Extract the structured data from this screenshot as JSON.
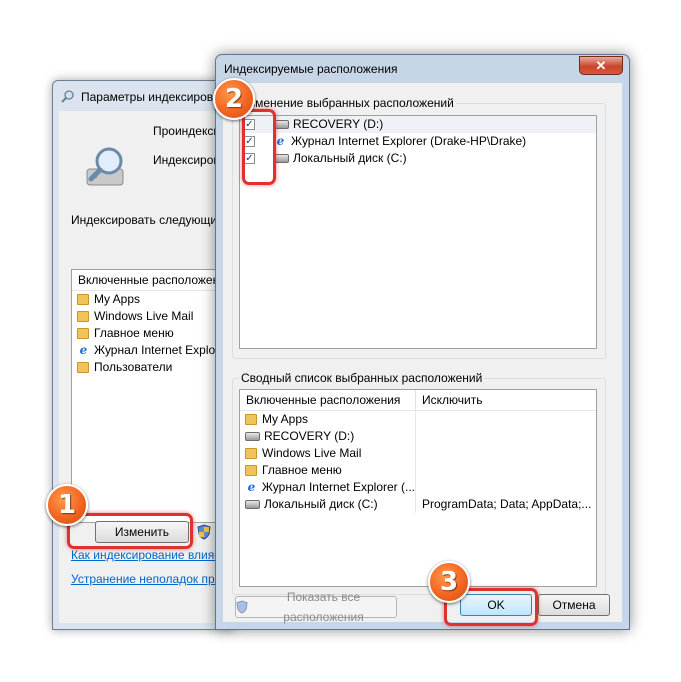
{
  "back_window": {
    "title": "Параметры индексиров",
    "status_line_1": "Проиндекси",
    "status_line_2": "Индексиров",
    "index_prompt": "Индексировать следующие",
    "list_header": "Включенные расположения",
    "items": [
      {
        "icon": "folder-icon",
        "label": "My Apps"
      },
      {
        "icon": "folder-icon",
        "label": "Windows Live Mail"
      },
      {
        "icon": "folder-icon",
        "label": "Главное меню"
      },
      {
        "icon": "ie-icon",
        "label": "Журнал Internet Explorer"
      },
      {
        "icon": "folder-icon",
        "label": "Пользователи"
      }
    ],
    "modify_button": "Изменить",
    "link1": "Как индексирование влияет",
    "link2": "Устранение неполадок при и"
  },
  "dialog": {
    "title": "Индексируемые расположения",
    "close": "✕",
    "group1_title": "Изменение выбранных расположений",
    "tree": [
      {
        "icon": "drive-icon",
        "label": "RECOVERY (D:)",
        "checked": true
      },
      {
        "icon": "ie-icon",
        "label": "Журнал Internet Explorer (Drake-HP\\Drake)",
        "checked": true
      },
      {
        "icon": "drive-icon",
        "label": "Локальный диск (C:)",
        "checked": true
      }
    ],
    "group2_title": "Сводный список выбранных расположений",
    "col_included": "Включенные расположения",
    "col_exclude": "Исключить",
    "summary": [
      {
        "icon": "folder-icon",
        "label": "My Apps",
        "exclude": ""
      },
      {
        "icon": "drive-icon",
        "label": "RECOVERY (D:)",
        "exclude": ""
      },
      {
        "icon": "folder-icon",
        "label": "Windows Live Mail",
        "exclude": ""
      },
      {
        "icon": "folder-icon",
        "label": "Главное меню",
        "exclude": ""
      },
      {
        "icon": "ie-icon",
        "label": "Журнал Internet Explorer (...",
        "exclude": ""
      },
      {
        "icon": "drive-icon",
        "label": "Локальный диск (C:)",
        "exclude": "ProgramData; Data; AppData;..."
      }
    ],
    "show_all_button": "Показать все расположения",
    "ok_button": "OK",
    "cancel_button": "Отмена"
  },
  "annotations": {
    "step1": "1",
    "step2": "2",
    "step3": "3"
  },
  "colors": {
    "badge": "#f26522",
    "highlight": "#e03030",
    "link": "#0066cc"
  }
}
